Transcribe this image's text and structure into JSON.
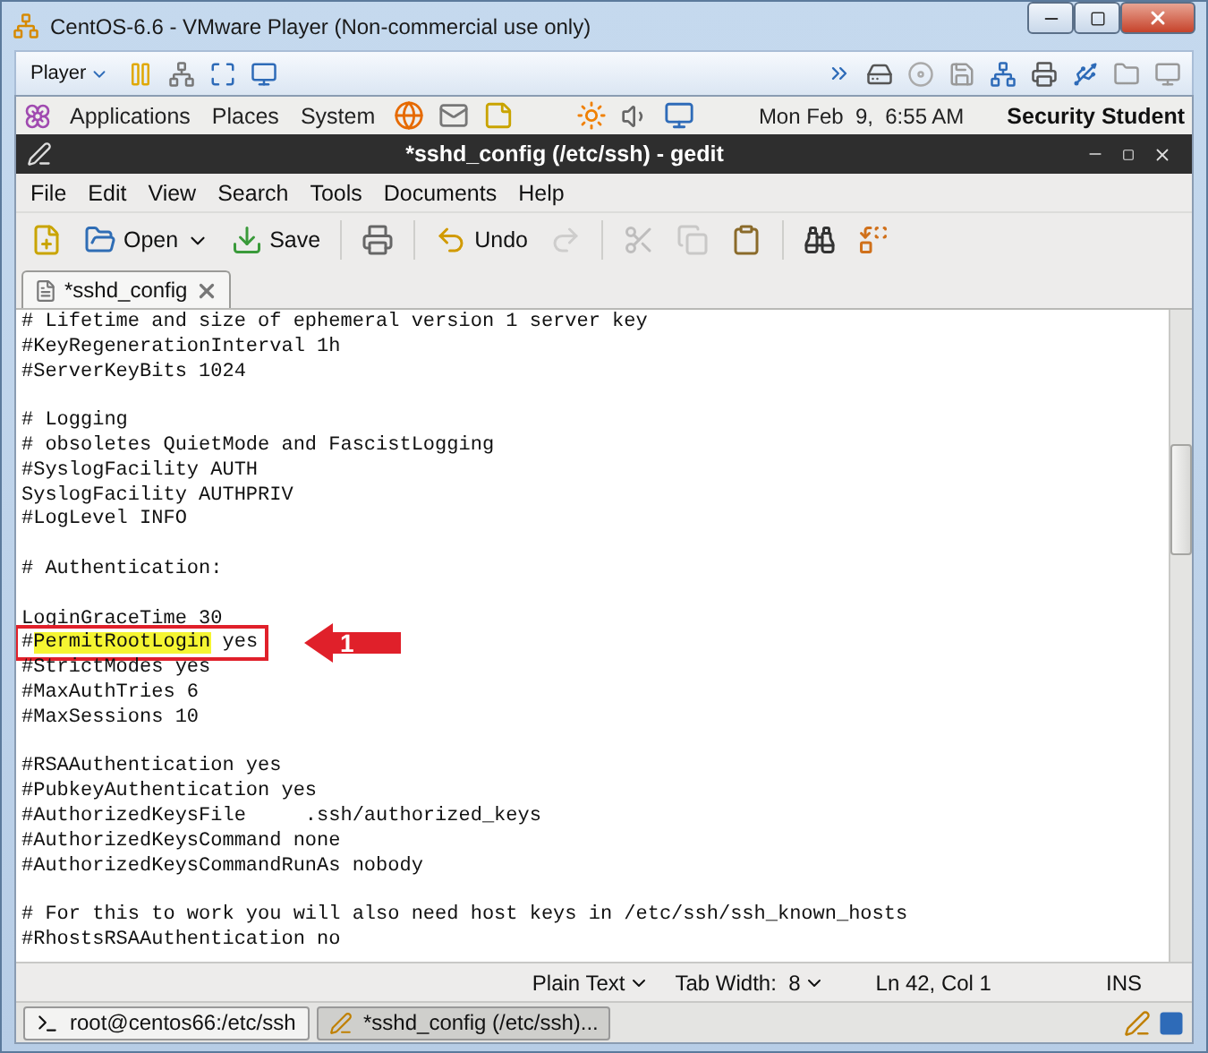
{
  "window": {
    "title": "CentOS-6.6 - VMware Player (Non-commercial use only)"
  },
  "player_toolbar": {
    "menu": "Player"
  },
  "panel": {
    "menus": [
      "Applications",
      "Places",
      "System"
    ],
    "clock": "Mon Feb  9,  6:55 AM",
    "user": "Security Student"
  },
  "gedit": {
    "title": "*sshd_config (/etc/ssh) - gedit",
    "menu": [
      "File",
      "Edit",
      "View",
      "Search",
      "Tools",
      "Documents",
      "Help"
    ],
    "toolbar": [
      [
        {
          "kind": "new",
          "disabled": false
        },
        {
          "kind": "open",
          "label": "Open",
          "disabled": false
        },
        {
          "kind": "save",
          "label": "Save",
          "disabled": false
        }
      ],
      [
        {
          "kind": "print",
          "disabled": false
        }
      ],
      [
        {
          "kind": "undo",
          "label": "Undo",
          "disabled": false
        },
        {
          "kind": "redo",
          "disabled": true
        }
      ],
      [
        {
          "kind": "cut",
          "disabled": true
        },
        {
          "kind": "copy",
          "disabled": true
        },
        {
          "kind": "paste",
          "disabled": false
        }
      ],
      [
        {
          "kind": "find",
          "disabled": false
        },
        {
          "kind": "replace",
          "disabled": false
        }
      ]
    ],
    "tabs": [
      {
        "label": "*sshd_config",
        "selected": true
      }
    ],
    "lines": [
      {
        "kind": "code",
        "segments": [
          {
            "text": "# Lifetime and size of ephemeral version 1 server key",
            "highlighted": false
          }
        ]
      },
      {
        "kind": "code",
        "segments": [
          {
            "text": "#KeyRegenerationInterval 1h",
            "highlighted": false
          }
        ]
      },
      {
        "kind": "code",
        "segments": [
          {
            "text": "#ServerKeyBits 1024",
            "highlighted": false
          }
        ]
      },
      {
        "kind": "blank"
      },
      {
        "kind": "code",
        "segments": [
          {
            "text": "# Logging",
            "highlighted": false
          }
        ]
      },
      {
        "kind": "code",
        "segments": [
          {
            "text": "# obsoletes QuietMode and FascistLogging",
            "highlighted": false
          }
        ]
      },
      {
        "kind": "code",
        "segments": [
          {
            "text": "#SyslogFacility AUTH",
            "highlighted": false
          }
        ]
      },
      {
        "kind": "code",
        "segments": [
          {
            "text": "SyslogFacility AUTHPRIV",
            "highlighted": false
          }
        ]
      },
      {
        "kind": "code",
        "segments": [
          {
            "text": "#LogLevel INFO",
            "highlighted": false
          }
        ]
      },
      {
        "kind": "blank"
      },
      {
        "kind": "code",
        "segments": [
          {
            "text": "# Authentication:",
            "highlighted": false
          }
        ]
      },
      {
        "kind": "blank"
      },
      {
        "kind": "code",
        "segments": [
          {
            "text": "LoginGraceTime 30",
            "highlighted": false
          }
        ]
      },
      {
        "kind": "code",
        "segments": [
          {
            "text": "#",
            "highlighted": false
          },
          {
            "text": "PermitRootLogin",
            "highlighted": true
          },
          {
            "text": " yes",
            "highlighted": false
          }
        ],
        "callout": "1"
      },
      {
        "kind": "code",
        "segments": [
          {
            "text": "#StrictModes yes",
            "highlighted": false
          }
        ]
      },
      {
        "kind": "code",
        "segments": [
          {
            "text": "#MaxAuthTries 6",
            "highlighted": false
          }
        ]
      },
      {
        "kind": "code",
        "segments": [
          {
            "text": "#MaxSessions 10",
            "highlighted": false
          }
        ]
      },
      {
        "kind": "blank"
      },
      {
        "kind": "code",
        "segments": [
          {
            "text": "#RSAAuthentication yes",
            "highlighted": false
          }
        ]
      },
      {
        "kind": "code",
        "segments": [
          {
            "text": "#PubkeyAuthentication yes",
            "highlighted": false
          }
        ]
      },
      {
        "kind": "code",
        "segments": [
          {
            "text": "#AuthorizedKeysFile     .ssh/authorized_keys",
            "highlighted": false
          }
        ]
      },
      {
        "kind": "code",
        "segments": [
          {
            "text": "#AuthorizedKeysCommand none",
            "highlighted": false
          }
        ]
      },
      {
        "kind": "code",
        "segments": [
          {
            "text": "#AuthorizedKeysCommandRunAs nobody",
            "highlighted": false
          }
        ]
      },
      {
        "kind": "blank"
      },
      {
        "kind": "code",
        "segments": [
          {
            "text": "# For this to work you will also need host keys in /etc/ssh/ssh_known_hosts",
            "highlighted": false
          }
        ]
      },
      {
        "kind": "code",
        "segments": [
          {
            "text": "#RhostsRSAAuthentication no",
            "highlighted": false
          }
        ]
      }
    ],
    "status_bar": {
      "language": "Plain Text",
      "tab_width": "Tab Width:  8",
      "position": "Ln 42, Col 1",
      "mode": "INS"
    }
  },
  "taskbar": [
    {
      "kind": "terminal",
      "label": "root@centos66:/etc/ssh",
      "selected": false
    },
    {
      "kind": "editor",
      "label": "*sshd_config (/etc/ssh)...",
      "selected": true
    }
  ]
}
